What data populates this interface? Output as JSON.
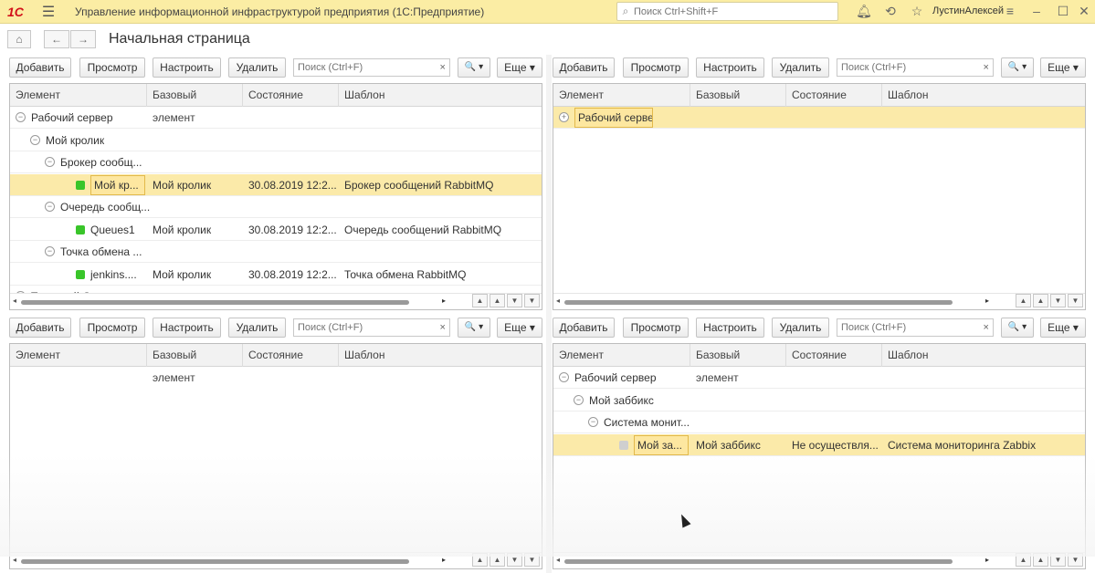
{
  "titlebar": {
    "logo": "1С",
    "title": "Управление информационной инфраструктурой предприятия  (1С:Предприятие)",
    "search_placeholder": "Поиск Ctrl+Shift+F",
    "user": "ЛустинАлексей"
  },
  "header": {
    "title": "Начальная страница",
    "home_icon": "home-icon",
    "back_icon": "arrow-left-icon",
    "forward_icon": "arrow-right-icon"
  },
  "toolbar": {
    "add": "Добавить",
    "view": "Просмотр",
    "configure": "Настроить",
    "delete": "Удалить",
    "search_placeholder": "Поиск (Ctrl+F)",
    "clear": "×",
    "more": "Еще ▾",
    "find": "🔍 ▾"
  },
  "columns": [
    "Элемент",
    "Базовый элемент",
    "Состояние",
    "Шаблон"
  ],
  "panel_tl": {
    "rows": [
      {
        "element": "Рабочий сервер",
        "toggle": "⊖"
      },
      {
        "element": "Мой кролик",
        "toggle": "⊖"
      },
      {
        "element": "Брокер сообщ...",
        "toggle": "⊖"
      },
      {
        "element": "Мой кр...",
        "base": "Мой кролик",
        "state": "30.08.2019 12:2...",
        "template": "Брокер сообщений RabbitMQ"
      },
      {
        "element": "Очередь сообщ...",
        "toggle": "⊖"
      },
      {
        "element": "Queues1",
        "base": "Мой кролик",
        "state": "30.08.2019 12:2...",
        "template": "Очередь сообщений RabbitMQ"
      },
      {
        "element": "Точка обмена ...",
        "toggle": "⊖"
      },
      {
        "element": "jenkins....",
        "base": "Мой кролик",
        "state": "30.08.2019 12:2...",
        "template": "Точка обмена RabbitMQ"
      },
      {
        "element": "Тестовый Сервер",
        "toggle": "⊖"
      }
    ]
  },
  "panel_tr": {
    "rows": [
      {
        "element": "Рабочий сервер",
        "toggle": "⊕"
      }
    ]
  },
  "panel_br": {
    "rows": [
      {
        "element": "Рабочий сервер",
        "toggle": "⊖"
      },
      {
        "element": "Мой заббикс",
        "toggle": "⊖"
      },
      {
        "element": "Система монит...",
        "toggle": "⊖"
      },
      {
        "element": "Мой за...",
        "base": "Мой заббикс",
        "state": "Не осуществля...",
        "template": "Система мониторинга Zabbix"
      }
    ]
  },
  "scroll": {
    "left": "◂",
    "right": "▸",
    "first": "▲",
    "up": "▲",
    "down": "▼",
    "last": "▼"
  }
}
